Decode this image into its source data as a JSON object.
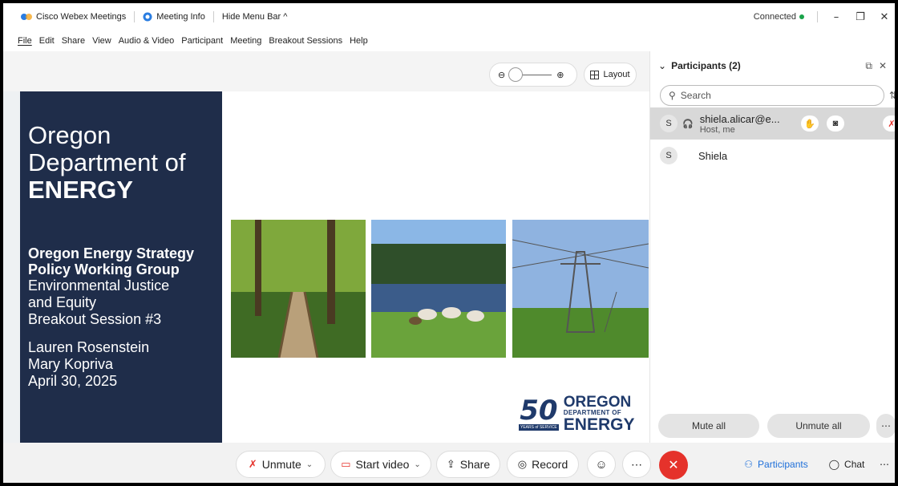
{
  "titlebar": {
    "app_name": "Cisco Webex Meetings",
    "meeting_info": "Meeting Info",
    "hide_menu": "Hide Menu Bar ^",
    "status": "Connected"
  },
  "menubar": [
    "File",
    "Edit",
    "Share",
    "View",
    "Audio & Video",
    "Participant",
    "Meeting",
    "Breakout Sessions",
    "Help"
  ],
  "stage": {
    "layout_label": "Layout"
  },
  "slide": {
    "title_line1": "Oregon",
    "title_line2": "Department of",
    "title_line3": "ENERGY",
    "subtitle_line1": "Oregon Energy Strategy",
    "subtitle_line2": "Policy Working Group",
    "line1": "Environmental Justice",
    "line2": "and Equity",
    "line3": "Breakout Session #3",
    "presenter1": "Lauren Rosenstein",
    "presenter2": "Mary Kopriva",
    "date": "April 30, 2025",
    "logo_number": "50",
    "logo_line1": "OREGON",
    "logo_line2": "DEPARTMENT OF",
    "logo_line3": "ENERGY",
    "logo_badge": "YEARS of SERVICE"
  },
  "toolbar": {
    "unmute": "Unmute",
    "start_video": "Start video",
    "share": "Share",
    "record": "Record",
    "participants": "Participants",
    "chat": "Chat"
  },
  "panel": {
    "title": "Participants (2)",
    "search_placeholder": "Search",
    "participants": [
      {
        "initial": "S",
        "name": "shiela.alicar@e...",
        "role": "Host, me"
      },
      {
        "initial": "S",
        "name": "Shiela",
        "role": ""
      }
    ],
    "mute_all": "Mute all",
    "unmute_all": "Unmute all"
  },
  "colors": {
    "slide_bg": "#1f2d4a",
    "end_call": "#e5322b",
    "accent_blue": "#1e6fd9",
    "mute_red": "#e5322b"
  }
}
